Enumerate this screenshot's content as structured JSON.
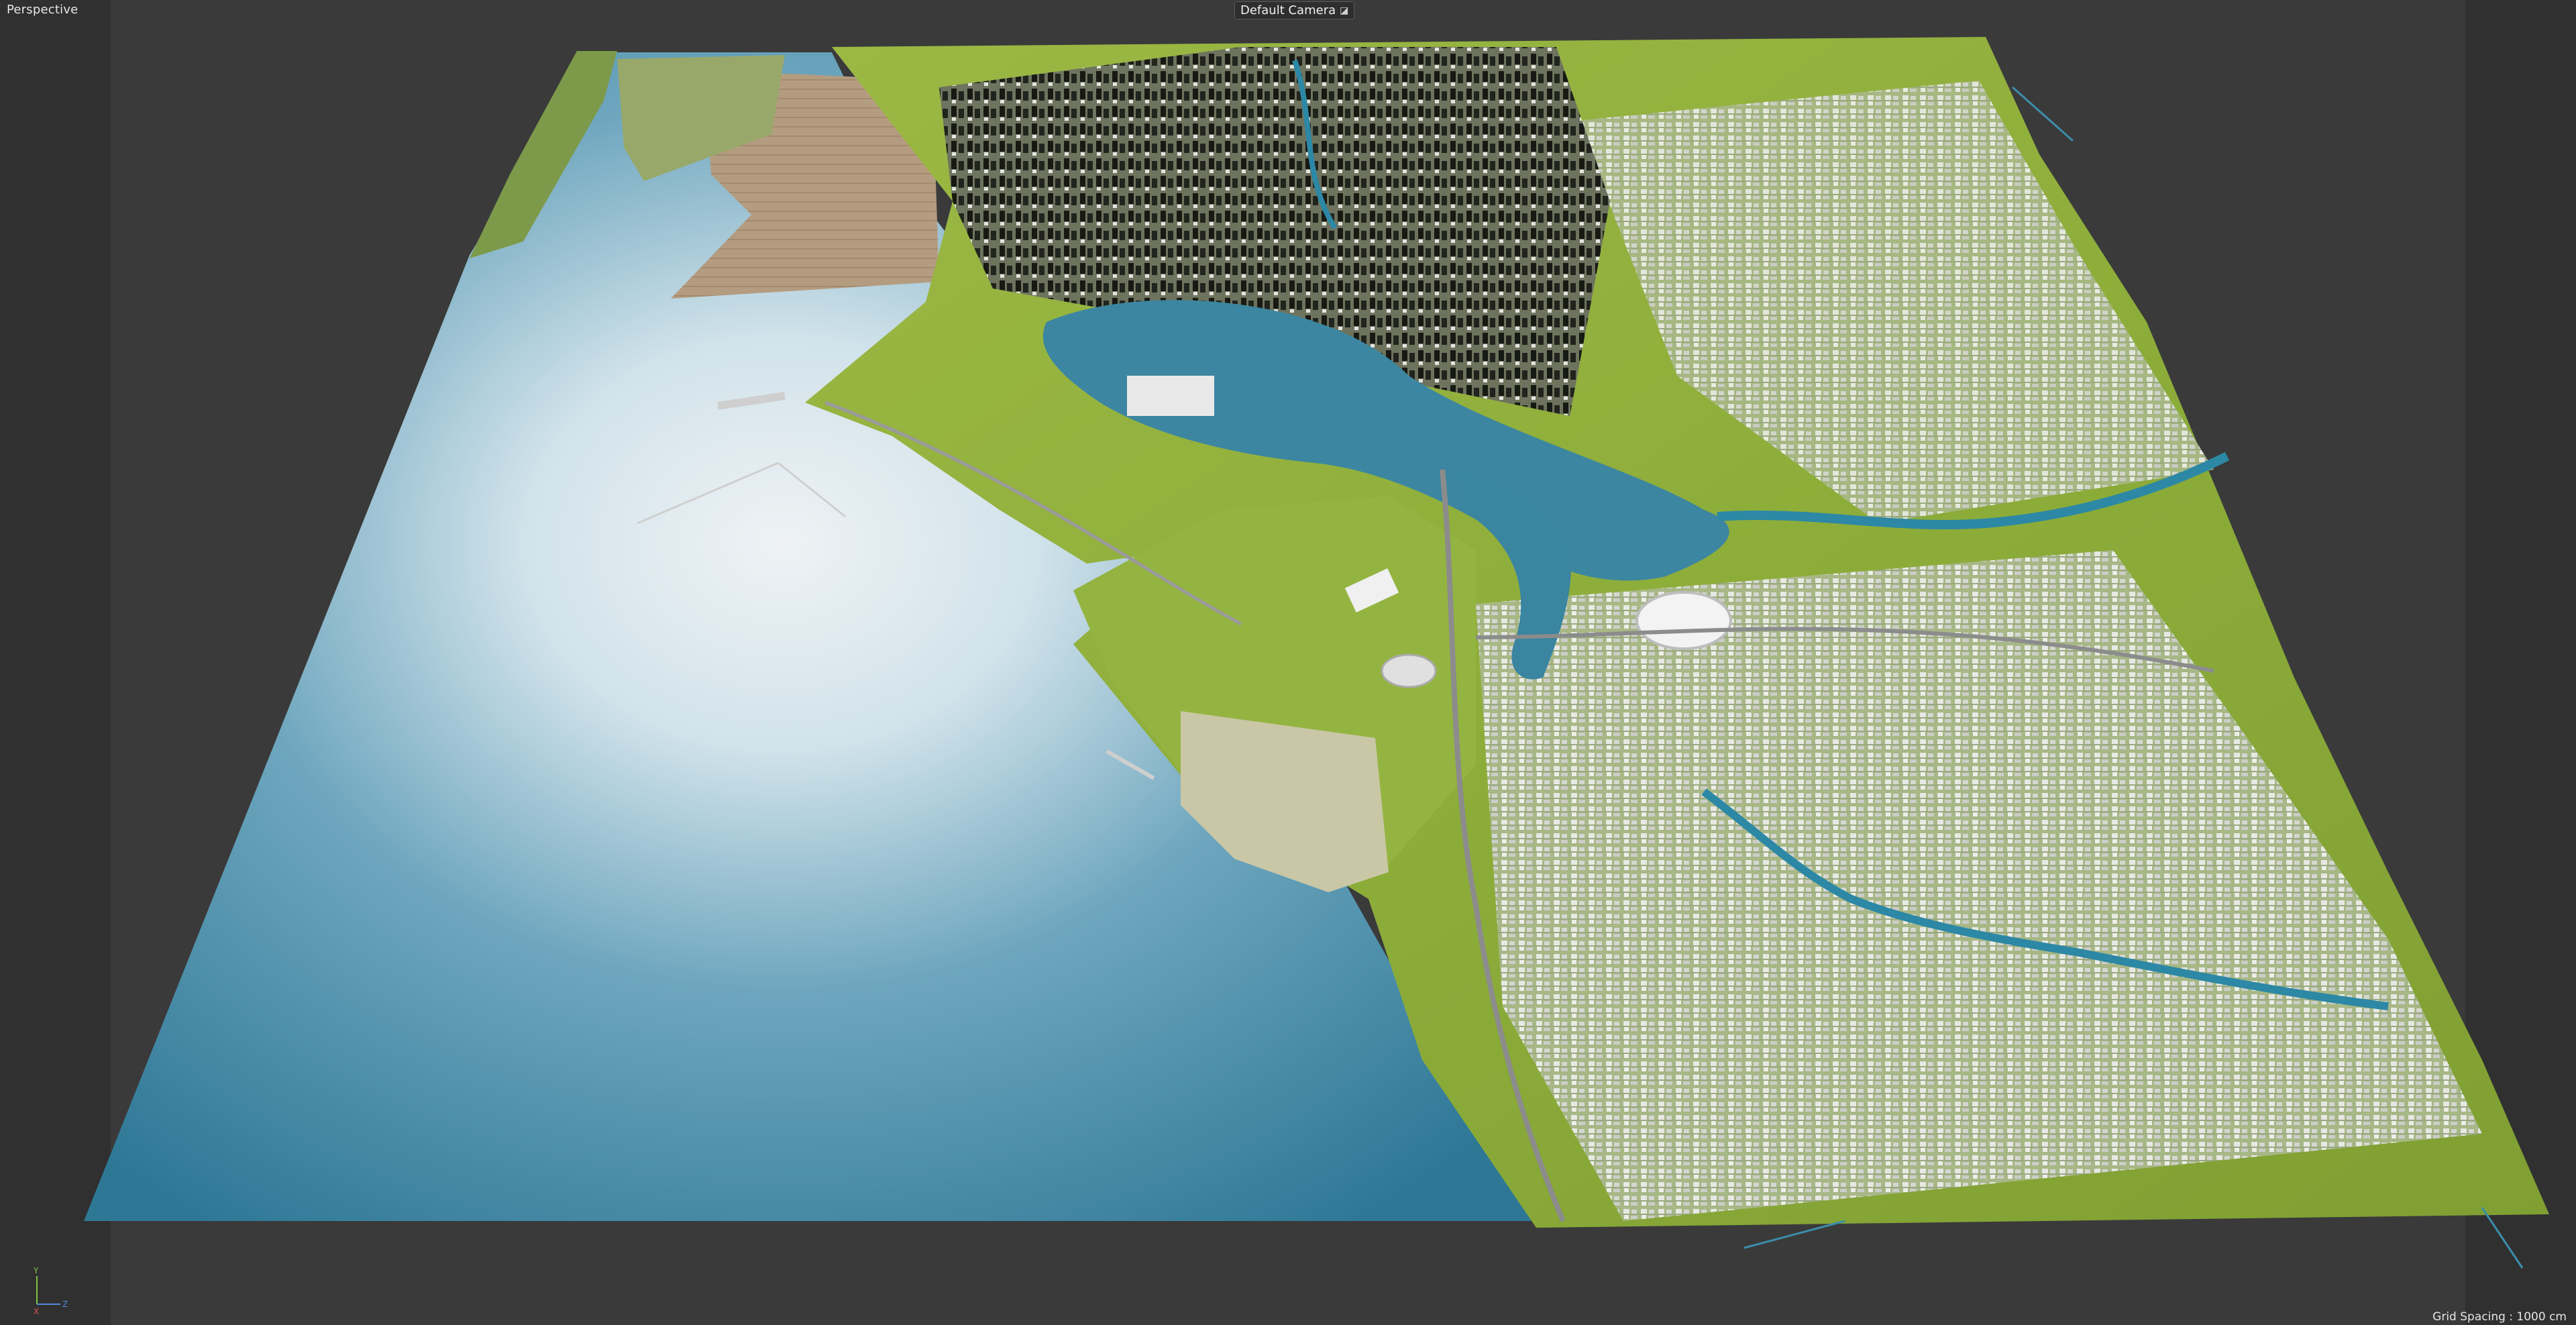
{
  "viewport": {
    "view_name": "Perspective",
    "camera_label": "Default Camera",
    "camera_icon": "camera-icon",
    "grid_spacing": "Grid Spacing : 1000 cm"
  },
  "axis_gizmo": {
    "x_label": "X",
    "y_label": "Y",
    "z_label": "Z",
    "x_color": "#d9534f",
    "y_color": "#7fc241",
    "z_color": "#4f8ad9"
  },
  "scene": {
    "description_colors": {
      "water_deep": "#2f7c9a",
      "water_light": "#dfeef5",
      "land": "#8fb13a",
      "river": "#2d8aa6",
      "buildings_light": "#e6e6e6",
      "buildings_dark": "#1a1a1a"
    }
  }
}
